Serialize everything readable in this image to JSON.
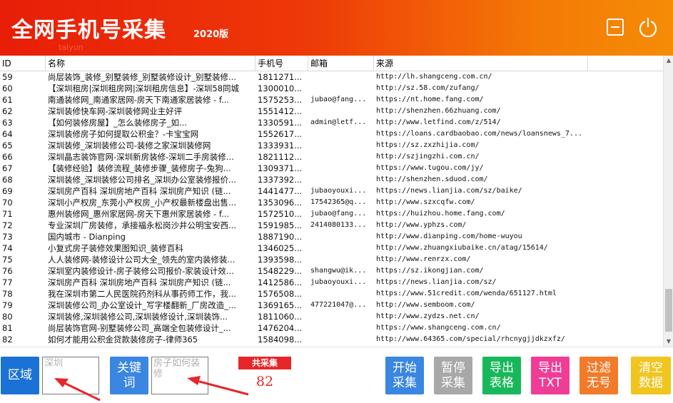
{
  "header": {
    "title": "全网手机号采集",
    "version": "2020版",
    "watermark": "talyun",
    "minimize_icon": "minimize-icon",
    "power_icon": "power-icon"
  },
  "table": {
    "columns": [
      "ID",
      "名称",
      "手机号",
      "邮箱",
      "来源"
    ],
    "rows": [
      [
        "59",
        "尚层装饰_装修_别墅装修_别墅装修设计_别墅装修...",
        "1811271...",
        "",
        "http://lh.shangceng.com.cn/"
      ],
      [
        "60",
        "【深圳租房|深圳租房网|深圳租房信息】-深圳58同城",
        "1300010...",
        "",
        "http://sz.58.com/zufang/"
      ],
      [
        "61",
        "南通装修网_南通家居网-房天下南通家居装修 - f...",
        "1575253...",
        "jubao@fang...",
        "https://nt.home.fang.com/"
      ],
      [
        "62",
        "深圳装修快车网-深圳装修网业主好评",
        "1551412...",
        "",
        "http://shenzhen.66zhuang.com/"
      ],
      [
        "63",
        "【如何装修房屋】_怎么装修房子_如...",
        "1330591...",
        "admin@letf...",
        "http://www.letfind.com/z/514/"
      ],
      [
        "64",
        "深圳装修房子如何提取公积金？-卡宝宝网",
        "1552617...",
        "",
        "https://loans.cardbaobao.com/news/loansnews_7..."
      ],
      [
        "65",
        "深圳装修_深圳装修公司-装修之家深圳装修网",
        "1333931...",
        "",
        "https://sz.zxzhijia.com/"
      ],
      [
        "66",
        "深圳晶志装饰官网-深圳新房装修-深圳二手房装修...",
        "1821112...",
        "",
        "http://szjingzhi.com.cn/"
      ],
      [
        "67",
        "【装修经验】装修流程_装修步骤_装修房子-兔狗...",
        "1309371...",
        "",
        "https://www.tugou.com/jy/"
      ],
      [
        "68",
        "深圳装修_深圳装修公司排名_深圳办公室装修报价...",
        "1337392...",
        "",
        "http://shenzhen.sduod.com/"
      ],
      [
        "69",
        "深圳房产百科 深圳房地产百科 深圳房产知识 (链...",
        "1441477...",
        "jubaoyouxi...",
        "https://news.lianjia.com/sz/baike/"
      ],
      [
        "70",
        "深圳小产权房_东莞小产权房_小产权最新楼盘出售...",
        "1353096...",
        "17542365@q...",
        "http://www.szxcqfw.com/"
      ],
      [
        "71",
        "惠州装修网_惠州家居网-房天下惠州家居装修 - f...",
        "1572510...",
        "jubao@fang...",
        "https://huizhou.home.fang.com/"
      ],
      [
        "72",
        "专业深圳厂房装修，承接福永松岗沙井公明宝安西...",
        "1591985...",
        "2414080133...",
        "http://www.yphzs.com/"
      ],
      [
        "73",
        "国内城市 - Dianping",
        "1887190...",
        "",
        "http://www.dianping.com/home-wuyou"
      ],
      [
        "74",
        "小复式房子装修效果图知识_装修百科",
        "1346025...",
        "",
        "http://www.zhuangxiubaike.cn/atag/15614/"
      ],
      [
        "75",
        "人人装修网-装修设计公司大全_领先的室内装修装...",
        "1393598...",
        "",
        "http://www.renrzx.com/"
      ],
      [
        "76",
        "深圳室内装修设计-房子装修公司报价-家装设计效...",
        "1548229...",
        "shangwu@ik...",
        "https://sz.ikongjian.com/"
      ],
      [
        "77",
        "深圳房产百科 深圳房地产百科 深圳房产知识 (链...",
        "1412586...",
        "jubaoyouxi...",
        "https://news.lianjia.com/sz/"
      ],
      [
        "78",
        "我在深圳市第二人民医院药剂科从事药师工作，我...",
        "1576508...",
        "",
        "https://www.51credit.com/wenda/651127.html"
      ],
      [
        "79",
        "深圳装修公司_办公室设计_写字楼翻新_厂房改造_...",
        "1369165...",
        "477221047@...",
        "http://www.semboom.com/"
      ],
      [
        "80",
        "深圳装修,深圳装修公司,深圳装修设计,深圳装饰...",
        "1811060...",
        "",
        "http://www.zydzs.net.cn/"
      ],
      [
        "81",
        "尚层装饰官网-别墅装修公司_高端全包装修设计_...",
        "1476204...",
        "",
        "https://www.shangceng.com.cn/"
      ],
      [
        "82",
        "如何才能用公积金贷款装修房子-律师365",
        "1584098...",
        "",
        "http://www.64365.com/special/rhcnygjjdkzxfz/"
      ]
    ]
  },
  "controls": {
    "region_label": "区域",
    "region_value": "深圳",
    "keyword_label": "关键词",
    "keyword_value": "房子如何装修",
    "total_label": "共采集",
    "total_count": "82",
    "buttons": [
      {
        "id": "start",
        "label": "开始采集",
        "color": "#3a86e0"
      },
      {
        "id": "pause",
        "label": "暂停采集",
        "color": "#a8a8a8"
      },
      {
        "id": "export-table",
        "label": "导出表格",
        "color": "#18b85a"
      },
      {
        "id": "export-txt",
        "label": "导出TXT",
        "color": "#ef3d96"
      },
      {
        "id": "filter",
        "label": "过滤无号",
        "color": "#f27b2a"
      },
      {
        "id": "clear",
        "label": "清空数据",
        "color": "#f0c51e"
      }
    ]
  }
}
